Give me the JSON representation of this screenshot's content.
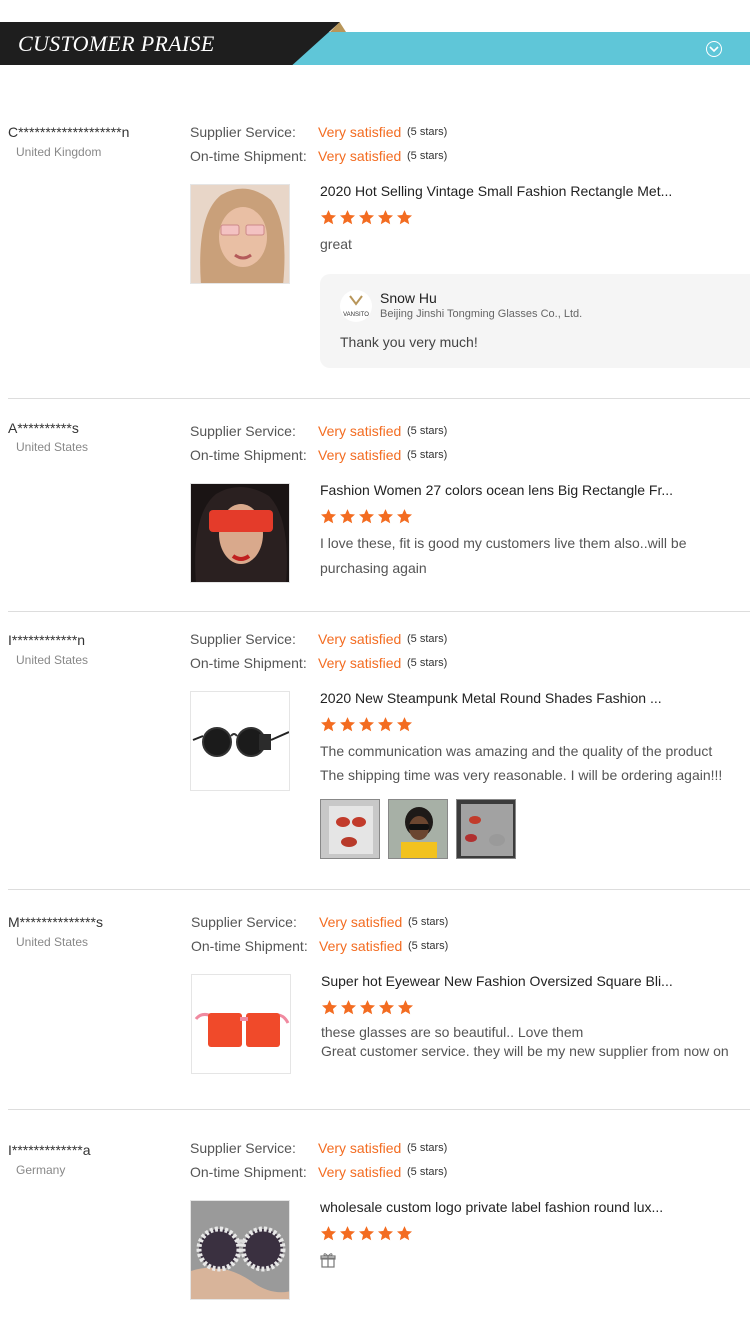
{
  "header": {
    "title": "CUSTOMER PRAISE",
    "toggle_icon": "chevron-down-circle-icon"
  },
  "labels": {
    "supplier_service": "Supplier Service:",
    "ontime_shipment": "On-time Shipment:"
  },
  "colors": {
    "accent": "#f36c21",
    "teal": "#5fc6d8",
    "dark": "#1e1e1e"
  },
  "reviews": [
    {
      "name": "C*******************n",
      "country": "United Kingdom",
      "supplier_service": "Very satisfied",
      "supplier_stars": "(5 stars)",
      "ontime_shipment": "Very satisfied",
      "ontime_stars": "(5 stars)",
      "product_title": "2020 Hot Selling Vintage Small Fashion Rectangle Met...",
      "rating": 5,
      "comment_lines": [
        "great"
      ],
      "reply": {
        "name": "Snow Hu",
        "company": "Beijing Jinshi Tongming Glasses Co., Ltd.",
        "logo_text": "VANSITO",
        "text": "Thank you very much!"
      }
    },
    {
      "name": "A**********s",
      "country": "United States",
      "supplier_service": "Very satisfied",
      "supplier_stars": "(5 stars)",
      "ontime_shipment": "Very satisfied",
      "ontime_stars": "(5 stars)",
      "product_title": "Fashion Women 27 colors ocean lens Big Rectangle Fr...",
      "rating": 5,
      "comment_lines": [
        "I love these, fit is good my customers live them also..will be",
        "purchasing again"
      ]
    },
    {
      "name": "I************n",
      "country": "United States",
      "supplier_service": "Very satisfied",
      "supplier_stars": "(5 stars)",
      "ontime_shipment": "Very satisfied",
      "ontime_stars": "(5 stars)",
      "product_title": "2020 New Steampunk Metal Round Shades Fashion ...",
      "rating": 5,
      "comment_lines": [
        "The communication was amazing and the quality of the product",
        "The shipping time was very reasonable. I will be ordering again!!!"
      ],
      "photo_count": 3
    },
    {
      "name": "M**************s",
      "country": "United States",
      "supplier_service": "Very satisfied",
      "supplier_stars": "(5 stars)",
      "ontime_shipment": "Very satisfied",
      "ontime_stars": "(5 stars)",
      "product_title": "Super hot Eyewear New Fashion Oversized Square Bli...",
      "rating": 5,
      "comment_lines": [
        "these glasses are so beautiful.. Love them",
        "Great customer service. they will be my new supplier from now on"
      ]
    },
    {
      "name": "I*************a",
      "country": "Germany",
      "supplier_service": "Very satisfied",
      "supplier_stars": "(5 stars)",
      "ontime_shipment": "Very satisfied",
      "ontime_stars": "(5 stars)",
      "product_title": "wholesale custom logo private label fashion round lux...",
      "rating": 5,
      "comment_lines": [],
      "comment_icon": "gift-icon"
    }
  ]
}
